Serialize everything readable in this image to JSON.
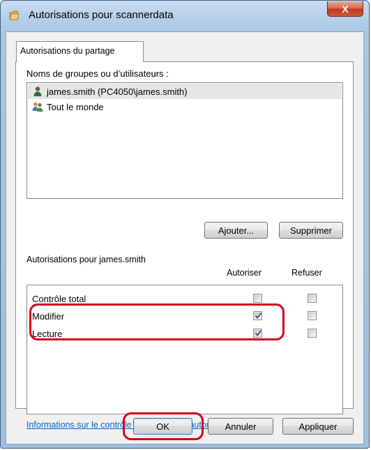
{
  "window": {
    "title": "Autorisations pour scannerdata",
    "close_glyph": "X"
  },
  "tab": {
    "label": "Autorisations du partage"
  },
  "groups": {
    "label": "Noms de groupes ou d’utilisateurs :",
    "items": [
      {
        "name": "james.smith (PC4050\\james.smith)",
        "icon": "user-icon",
        "selected": true
      },
      {
        "name": "Tout le monde",
        "icon": "users-group-icon",
        "selected": false
      }
    ],
    "add_label": "Ajouter...",
    "remove_label": "Supprimer"
  },
  "permissions": {
    "label": "Autorisations pour james.smith",
    "allow_header": "Autoriser",
    "deny_header": "Refuser",
    "rows": [
      {
        "name": "Contrôle total",
        "allow": false,
        "deny": false
      },
      {
        "name": "Modifier",
        "allow": true,
        "deny": false
      },
      {
        "name": "Lecture",
        "allow": true,
        "deny": false
      }
    ]
  },
  "info_link": "Informations sur le contrôle d’accès et les autorisations",
  "buttons": {
    "ok": "OK",
    "cancel": "Annuler",
    "apply": "Appliquer"
  },
  "colors": {
    "annotation": "#d0021b",
    "link": "#0066cc",
    "close_button": "#c0381d"
  }
}
